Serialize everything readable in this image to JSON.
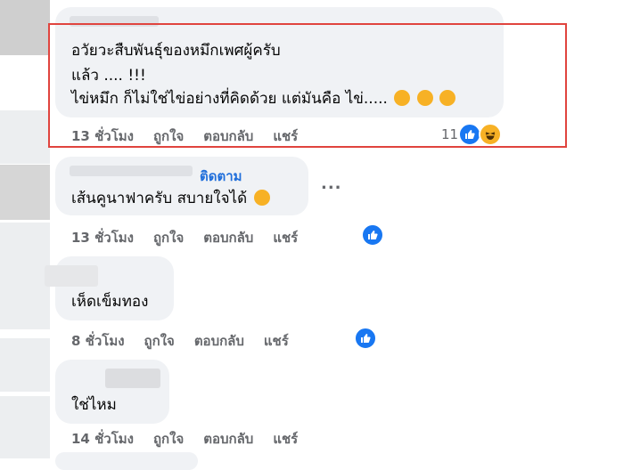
{
  "comments": [
    {
      "lines": [
        "อวัยวะสืบพันธุ์ของหมึกเพศผู้ครับ",
        "แล้ว .... !!!",
        "ไข่หมึก ก็ไม่ใช่ไข่อย่างที่คิดด้วย แต่มันคือ ไข่....."
      ],
      "time": "13 ชั่วโมง",
      "like": "ถูกใจ",
      "reply": "ตอบกลับ",
      "share": "แชร์",
      "reaction_count": "11",
      "reactions": [
        "like-icon",
        "haha-icon"
      ]
    },
    {
      "follow": "ติดตาม",
      "lines": [
        "เส้นคูนาฟาครับ สบายใจได้"
      ],
      "time": "13 ชั่วโมง",
      "like": "ถูกใจ",
      "reply": "ตอบกลับ",
      "share": "แชร์",
      "more": "..."
    },
    {
      "lines": [
        "เห็ดเข็มทอง"
      ],
      "time": "8 ชั่วโมง",
      "like": "ถูกใจ",
      "reply": "ตอบกลับ",
      "share": "แชร์"
    },
    {
      "lines": [
        "ใช่ไหม"
      ],
      "time": "14 ชั่วโมง",
      "like": "ถูกใจ",
      "reply": "ตอบกลับ",
      "share": "แชร์"
    }
  ],
  "colors": {
    "accent": "#1877f2",
    "highlight": "#e0443e",
    "bubble": "#f0f2f5"
  }
}
